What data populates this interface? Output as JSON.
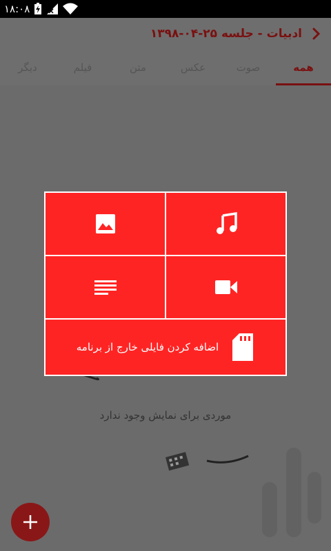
{
  "status_bar": {
    "time": "۱۸:۰۸"
  },
  "app_bar": {
    "title": "ادبیات - جلسه ۲۵-۰۴-۱۳۹۸"
  },
  "tabs": [
    {
      "label": "همه",
      "active": true
    },
    {
      "label": "صوت",
      "active": false
    },
    {
      "label": "عکس",
      "active": false
    },
    {
      "label": "متن",
      "active": false
    },
    {
      "label": "فیلم",
      "active": false
    },
    {
      "label": "دیگر",
      "active": false
    }
  ],
  "empty_state": {
    "message": "موردی برای نمایش وجود ندارد"
  },
  "dialog": {
    "options": [
      {
        "icon": "image-icon"
      },
      {
        "icon": "music-icon"
      },
      {
        "icon": "text-icon"
      },
      {
        "icon": "video-icon"
      }
    ],
    "external_file_label": "اضافه کردن فایلی خارج از برنامه",
    "external_file_icon": "sd-card-icon"
  },
  "colors": {
    "accent": "#ff2424",
    "dim_accent": "#7a1010",
    "overlay_bg": "#6b6b6b"
  }
}
